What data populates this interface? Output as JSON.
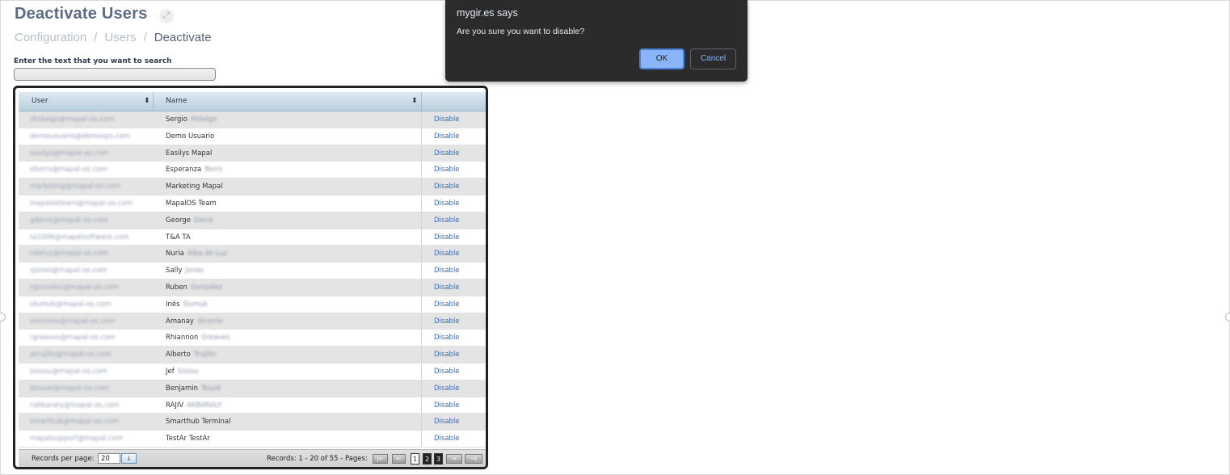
{
  "header": {
    "title": "Deactivate Users",
    "breadcrumb": [
      "Configuration",
      "Users",
      "Deactivate"
    ]
  },
  "search": {
    "label": "Enter the text that you want to search",
    "value": ""
  },
  "grid": {
    "columns": [
      "User",
      "Name"
    ],
    "action_label": "Disable",
    "rows": [
      {
        "user": "shidalgo@mapal-os.com",
        "first": "Sergio",
        "last": "Hidalgo"
      },
      {
        "user": "demousuario@demoops.com",
        "first": "Demo Usuario",
        "last": ""
      },
      {
        "user": "easilys@mapal-os.com",
        "first": "Easilys Mapal",
        "last": ""
      },
      {
        "user": "eborrs@mapal-os.com",
        "first": "Esperanza",
        "last": "Borrs"
      },
      {
        "user": "marketing@mapal-os.com",
        "first": "Marketing Mapal",
        "last": ""
      },
      {
        "user": "mapalosteam@mapal-os.com",
        "first": "MapalOS Team",
        "last": ""
      },
      {
        "user": "gdavis@mapal-os.com",
        "first": "George",
        "last": "Davis"
      },
      {
        "user": "ta1006@mapalsoftware.com",
        "first": "T&A TA",
        "last": ""
      },
      {
        "user": "ndeluz@mapal-os.com",
        "first": "Nuria",
        "last": "Alba de Luz"
      },
      {
        "user": "sjones@mapal-os.com",
        "first": "Sally",
        "last": "Jones"
      },
      {
        "user": "rgonzalez@mapal-os.com",
        "first": "Ruben",
        "last": "Gonzalez"
      },
      {
        "user": "idumuk@mapal-os.com",
        "first": "Inés",
        "last": "Dumuk"
      },
      {
        "user": "avicente@mapal-os.com",
        "first": "Amanay",
        "last": "Vicente"
      },
      {
        "user": "rgreaves@mapal-os.com",
        "first": "Rhiannon",
        "last": "Greaves"
      },
      {
        "user": "atrujillo@mapal-os.com",
        "first": "Alberto",
        "last": "Trujillo"
      },
      {
        "user": "jsousu@mapal-os.com",
        "first": "Jef",
        "last": "Sousu"
      },
      {
        "user": "btouze@mapal-os.com",
        "first": "Benjamin",
        "last": "Touzé"
      },
      {
        "user": "rabbaraty@mapal-os.com",
        "first": "RAJIV",
        "last": "AKBARALY"
      },
      {
        "user": "smarthub@mapal-os.com",
        "first": "Smarthub Terminal",
        "last": ""
      },
      {
        "user": "mapalsupport@mapal.com",
        "first": "TestAr TestAr",
        "last": ""
      }
    ]
  },
  "footer": {
    "records_per_page_label": "Records per page:",
    "records_per_page": "20",
    "records_info": "Records: 1 - 20 of 55 - Pages:",
    "pages": [
      "1",
      "2",
      "3"
    ],
    "current_page": "1"
  },
  "dialog": {
    "title": "mygir.es says",
    "message": "Are you sure you want to disable?",
    "ok": "OK",
    "cancel": "Cancel"
  },
  "icons": {
    "expand": "expand-icon",
    "sort": "sort-icon",
    "dropdown": "arrow-down-icon",
    "first": "first-page-icon",
    "prev": "prev-page-icon",
    "next": "next-page-icon",
    "last": "last-page-icon"
  }
}
